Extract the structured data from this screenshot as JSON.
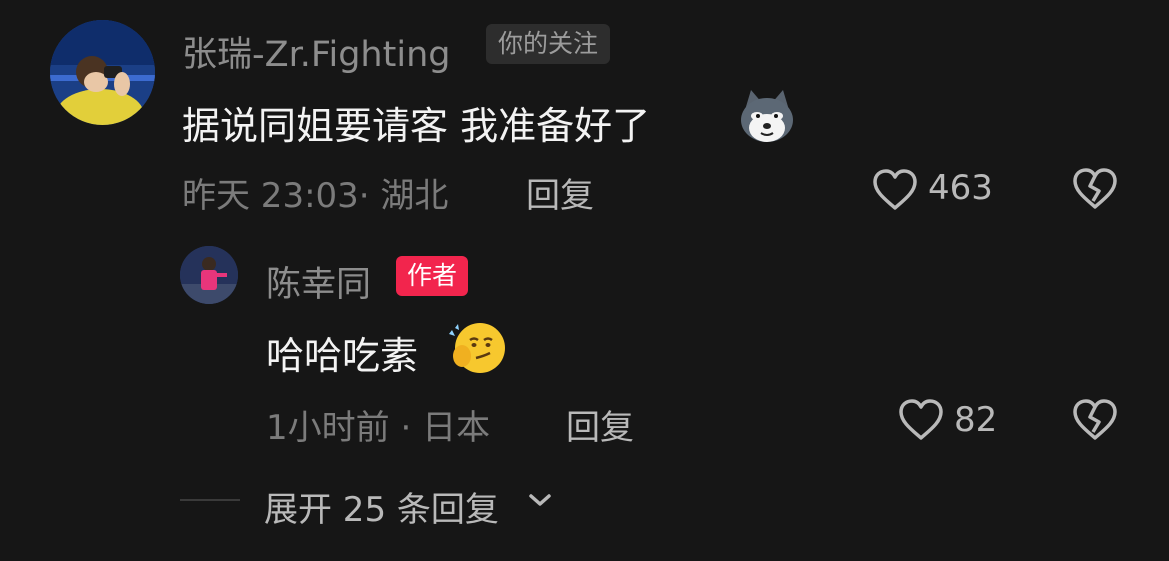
{
  "comment": {
    "username": "张瑞-Zr.Fighting",
    "badge": "你的关注",
    "text": "据说同姐要请客 我准备好了",
    "emoji": "husky-dog-emoji",
    "time": "昨天 23:03",
    "location": "· 湖北",
    "reply_label": "回复",
    "likes": "463"
  },
  "reply": {
    "username": "陈幸同",
    "badge": "作者",
    "text": "哈哈吃素",
    "emoji": "smirk-thinking-emoji",
    "time": "1小时前",
    "location": "· 日本",
    "reply_label": "回复",
    "likes": "82"
  },
  "expand": {
    "label": "展开 25 条回复"
  },
  "colors": {
    "background": "#161616",
    "author_badge": "#f2254d",
    "follow_badge": "#2d2d2d"
  }
}
